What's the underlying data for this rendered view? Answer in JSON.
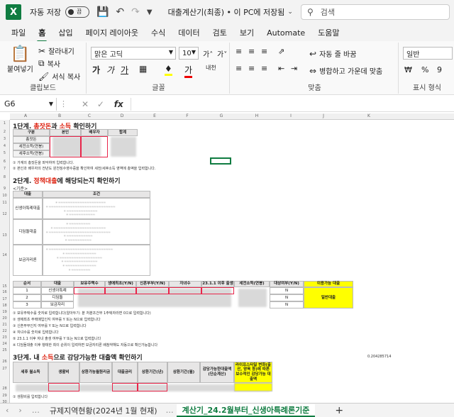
{
  "titlebar": {
    "autosave_label": "자동 저장",
    "autosave_state": "끔",
    "doc_title": "대출계산기(최종) • 이 PC에 저장됨",
    "search_placeholder": "검색"
  },
  "tabs": [
    "파일",
    "홈",
    "삽입",
    "페이지 레이아웃",
    "수식",
    "데이터",
    "검토",
    "보기",
    "Automate",
    "도움말"
  ],
  "active_tab": "홈",
  "ribbon": {
    "clipboard": {
      "paste": "붙여넣기",
      "cut": "잘라내기",
      "copy": "복사",
      "format_painter": "서식 복사",
      "label": "클립보드"
    },
    "font": {
      "name": "맑은 고딕",
      "size": "10",
      "label": "글꼴",
      "bold": "가",
      "italic": "가",
      "underline": "가"
    },
    "align": {
      "wrap": "자동 줄 바꿈",
      "merge": "병합하고 가운데 맞춤",
      "label": "맞춤"
    },
    "number": {
      "format": "일반",
      "label": "표시 형식"
    }
  },
  "formula_bar": {
    "cell_ref": "G6",
    "fx": "fx",
    "value": ""
  },
  "sheet": {
    "columns": [
      "A",
      "B",
      "C",
      "D",
      "E",
      "F",
      "G",
      "H",
      "I",
      "J",
      "K"
    ],
    "rows": [
      "1",
      "2",
      "3",
      "4",
      "5",
      "6",
      "7",
      "8",
      "9",
      "10",
      "11",
      "12",
      "13",
      "14",
      "15",
      "16",
      "17",
      "18",
      "19",
      "20",
      "21",
      "22",
      "23",
      "24",
      "25",
      "26",
      "27",
      "28",
      "29",
      "30"
    ],
    "section1": {
      "title_pre": "1단계. ",
      "title_red1": "총잣돈",
      "title_mid": "과 ",
      "title_red2": "소득",
      "title_post": " 확인하기",
      "headers": [
        "구분",
        "본인",
        "배우자",
        "합계"
      ],
      "rows": [
        "총잣돈",
        "세전소득(연봉)",
        "세후소득(연봉)"
      ],
      "notes": [
        "① 가계의 총잣돈을 파악하여 입력합니다.",
        "② 본인과 배우자의 전년도 원천징수영수증을 확인하여 세전/세후소득 영역에 총액을 입력합니다."
      ]
    },
    "section2": {
      "title_pre": "2단계. ",
      "title_red": "정책대출",
      "title_post": "에 해당되는지 확인하기",
      "sub": "<기준>",
      "headers": [
        "대출",
        "조건"
      ],
      "loans": [
        "신생아특례대출",
        "디딤돌대출",
        "보금자리론"
      ],
      "table_headers": [
        "순서",
        "대출",
        "보유주택수",
        "생애최초(Y/N)",
        "신혼부부(Y/N)",
        "자녀수",
        "23.1.1 이후 출생",
        "세전소득(연봉)",
        "대상여부(Y/N)",
        "이용가능 대출"
      ],
      "table_rows": [
        [
          "1",
          "신생아특례",
          "N"
        ],
        [
          "2",
          "디딤돌",
          "N"
        ],
        [
          "3",
          "보금자리",
          "N"
        ]
      ],
      "result": "일반대출",
      "notes": [
        "① 보유주택수를 숫자로 입력합니다(알아두기: 분 처분조건부 1주택자라면 0으로 입력합니다)",
        "② 생애최초 주택매입인지 여부를 Y 또는 N으로 입력합니다",
        "③ 신혼부부인지 여부를 Y 또는 N으로 입력합니다",
        "④ 자녀수를 숫자로 입력합니다",
        "⑤ 23.1.1 이후 자녀 출생 여부를 Y 또는 N으로 입력합니다",
        "※ 디딤돌대출 이후 행태한 최이 순위이 입력하면 보금자리론 배참약해도 자동으로 확인가능합니다"
      ]
    },
    "section3": {
      "title_pre": "3단계. 내 ",
      "title_red": "소득",
      "title_post": "으로 감당가능한 대출액 확인하기",
      "number": "0.204285714",
      "headers": [
        "세후 월소득",
        "생활비",
        "상환가능월원리금",
        "대출금리",
        "상환기간(년)",
        "상환기간(월)",
        "감당가능한대출액(단순계산)",
        "라이프스타일 변화(출산, 양육 등)에 따른 보수적인 감당가능 대출액"
      ],
      "notes": [
        "① 생활비를 입력합니다"
      ]
    }
  },
  "sheet_tabs": [
    "규제지역현황(2024년 1월 현재)",
    "계산기_24.2월부터_신생아특례론기준",
    "+"
  ],
  "active_sheet_tab": "계산기_24.2월부터_신생아특례론기준",
  "colors": {
    "excel_green": "#107c41",
    "highlight_red": "#e8254a",
    "yellow": "#ffff00"
  }
}
